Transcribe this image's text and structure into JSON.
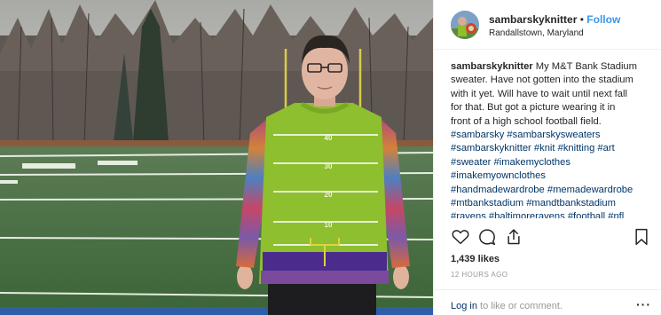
{
  "header": {
    "username": "sambarskyknitter",
    "separator": "•",
    "follow_label": "Follow",
    "location": "Randallstown, Maryland"
  },
  "caption": {
    "username": "sambarskyknitter",
    "lines": [
      "My M&T Bank Stadium",
      "sweater. Have not gotten into the stadium",
      "with it yet. Will have to wait until next fall",
      "for that. But got a picture wearing it in",
      "front of a high school football field."
    ],
    "hashtags": [
      "#sambarsky #sambarskysweaters",
      "#sambarskyknitter #knit #knitting #art",
      "#sweater #imakemyclothes",
      "#imakemyownclothes",
      "#handmadewardrobe #memadewardrobe",
      "#mtbankstadium #mandtbankstadium",
      "#ravens #baltimoreravens #football #nfl"
    ]
  },
  "actions": {
    "icons": [
      "heart-icon",
      "comment-icon",
      "share-icon",
      "bookmark-icon"
    ]
  },
  "likes": "1,439 likes",
  "time_ago": "12 HOURS AGO",
  "comment_bar": {
    "login_label": "Log in",
    "rest": " to like or comment.",
    "more_label": "···"
  },
  "photo": {
    "sweater_numbers": [
      "40",
      "30",
      "20",
      "10"
    ]
  },
  "colors": {
    "link_blue": "#3897f0",
    "hashtag_navy": "#003569",
    "meta_gray": "#999999",
    "sweater_green": "#8dbf2e",
    "field_green": "#3f6b3a"
  }
}
